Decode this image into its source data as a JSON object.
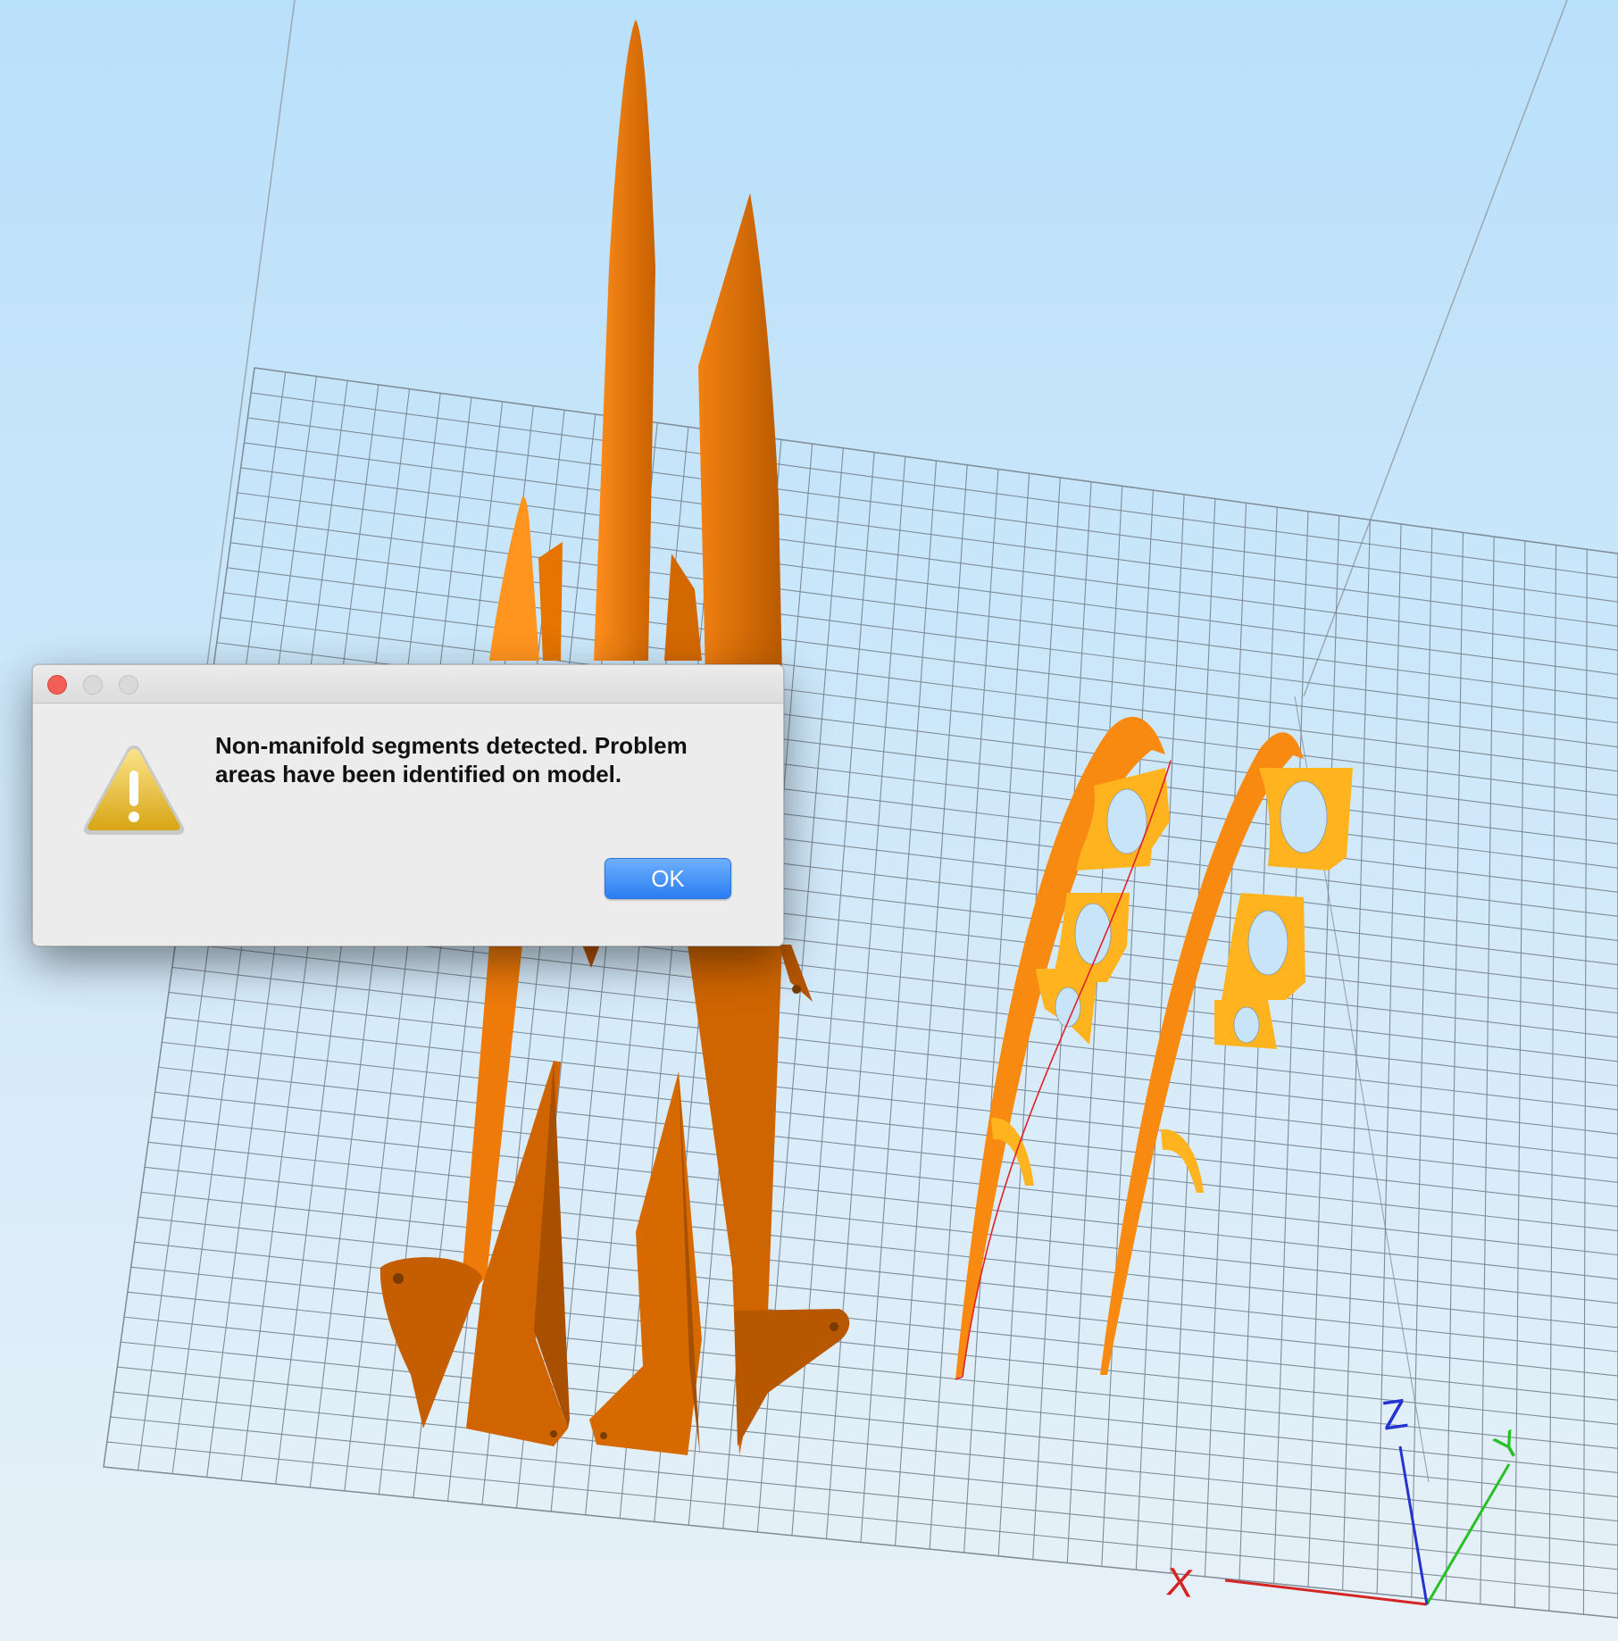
{
  "dialog": {
    "message": "Non-manifold segments detected.  Problem areas have been identified on model.",
    "ok_label": "OK",
    "icon": "warning-triangle-icon"
  },
  "axes": {
    "x_label": "X",
    "y_label": "Y",
    "z_label": "Z",
    "x_color": "#d42424",
    "y_color": "#27c127",
    "z_color": "#2433cf"
  },
  "colors": {
    "background_top": "#b9e0fb",
    "background_bottom": "#e7f1f8",
    "part_dark": "#d86a00",
    "part_light": "#ff8c1a",
    "rib_color": "#ffb41f",
    "problem_outline": "#e0202a",
    "grid": "#7f8c96"
  }
}
